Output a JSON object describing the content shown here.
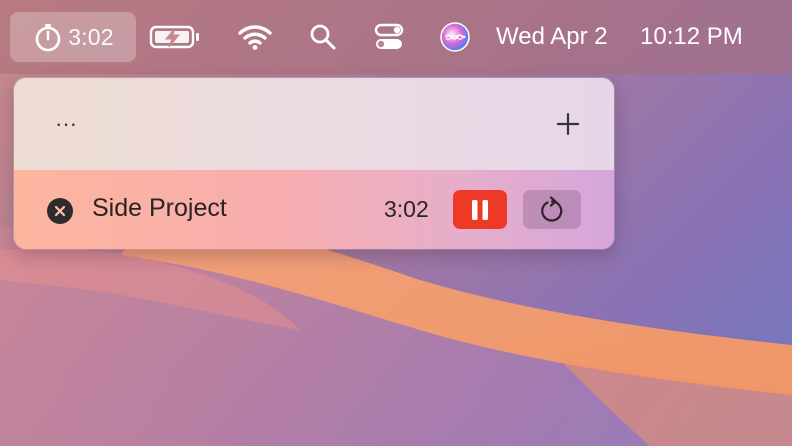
{
  "menubar": {
    "timer_text": "3:02",
    "date": "Wed Apr 2",
    "time": "10:12 PM",
    "icons": {
      "timer": "stopwatch-icon",
      "battery": "battery-charging-icon",
      "wifi": "wifi-icon",
      "search": "search-icon",
      "control_center": "control-center-icon",
      "siri": "siri-icon"
    }
  },
  "popover": {
    "more_label": "···",
    "add_icon": "plus-icon",
    "timers": [
      {
        "name": "Side Project",
        "time": "3:02",
        "remove_icon": "close-circle-icon",
        "pause_icon": "pause-icon",
        "reset_icon": "reset-icon"
      }
    ]
  },
  "colors": {
    "pause_button": "#ec3a27",
    "reset_button": "#a08aa5",
    "row_start": "#fdb69e",
    "row_end": "#d6a6dc",
    "header": "#ebdae3"
  }
}
